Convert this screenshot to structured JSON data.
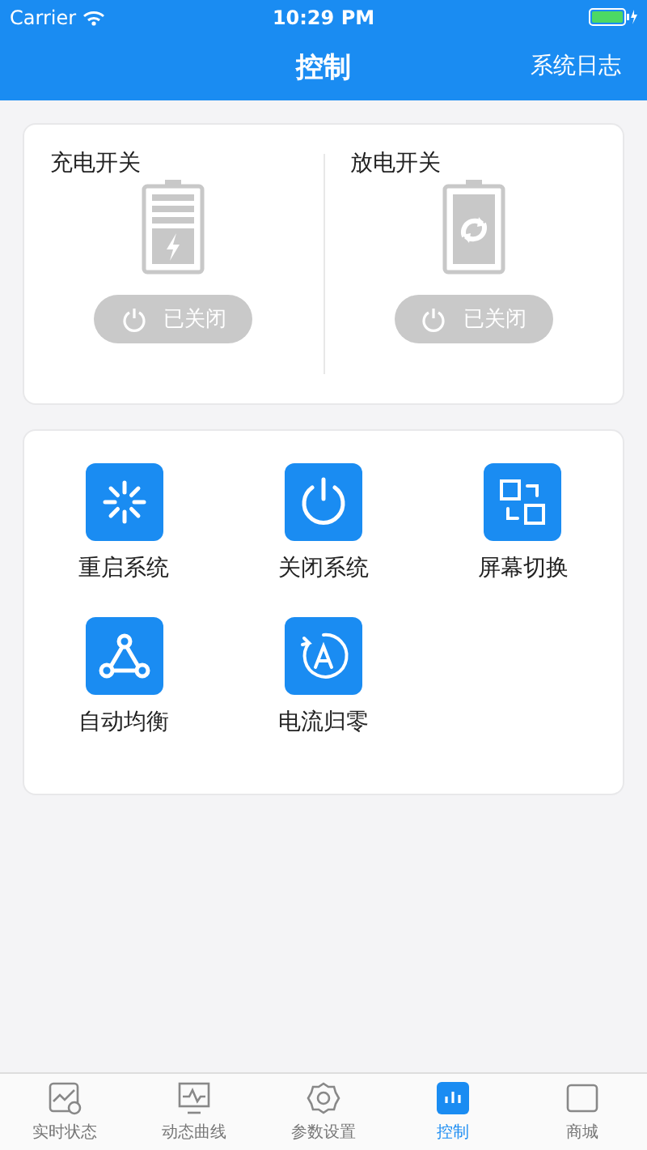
{
  "status_bar": {
    "carrier": "Carrier",
    "time": "10:29 PM"
  },
  "nav": {
    "title": "控制",
    "action": "系统日志"
  },
  "switches": [
    {
      "kind": "charge",
      "label": "充电开关",
      "on": false,
      "status": "已关闭"
    },
    {
      "kind": "discharge",
      "label": "放电开关",
      "on": false,
      "status": "已关闭"
    }
  ],
  "actions": [
    {
      "kind": "restart",
      "label": "重启系统"
    },
    {
      "kind": "power",
      "label": "关闭系统"
    },
    {
      "kind": "screen",
      "label": "屏幕切换"
    },
    {
      "kind": "balance",
      "label": "自动均衡"
    },
    {
      "kind": "zero",
      "label": "电流归零"
    }
  ],
  "tab_bar": [
    {
      "kind": "status",
      "label": "实时状态",
      "selected": false
    },
    {
      "kind": "curve",
      "label": "动态曲线",
      "selected": false
    },
    {
      "kind": "settings",
      "label": "参数设置",
      "selected": false
    },
    {
      "kind": "control",
      "label": "控制",
      "selected": true
    },
    {
      "kind": "shop",
      "label": "商城",
      "selected": false
    }
  ]
}
